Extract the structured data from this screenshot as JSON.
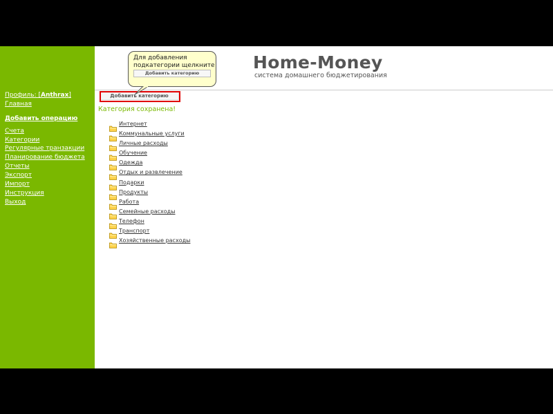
{
  "sidebar": {
    "profile_prefix": "Профиль: [",
    "profile_user": "Anthrax",
    "profile_suffix": "]",
    "home": "Главная",
    "add_operation": "Добавить операцию",
    "items": [
      "Счета",
      "Категории",
      "Регулярные транзакции",
      "Планирование бюджета",
      "Отчеты",
      "Экспорт",
      "Импорт",
      "Инструкция",
      "Выход"
    ]
  },
  "header": {
    "title": "Home-Money",
    "subtitle": "система домашнего бюджетирования"
  },
  "tooltip": {
    "line1": "Для добавления",
    "line2": "подкатегории щелкните",
    "button": "Добавить категорию"
  },
  "main": {
    "add_button": "Добавить категорию",
    "status": "Категория сохранена!",
    "categories": [
      "Интернет",
      "Коммунальные услуги",
      "Личные расходы",
      "Обучение",
      "Одежда",
      "Отдых и развлечение",
      "Подарки",
      "Продукты",
      "Работа",
      "Семейные расходы",
      "Телефон",
      "Транспорт",
      "Хозяйственные расходы"
    ]
  },
  "colors": {
    "sidebar_bg": "#7ab800",
    "status_text": "#7ab800",
    "tooltip_bg": "#ffffcc",
    "highlight": "#e00000"
  }
}
